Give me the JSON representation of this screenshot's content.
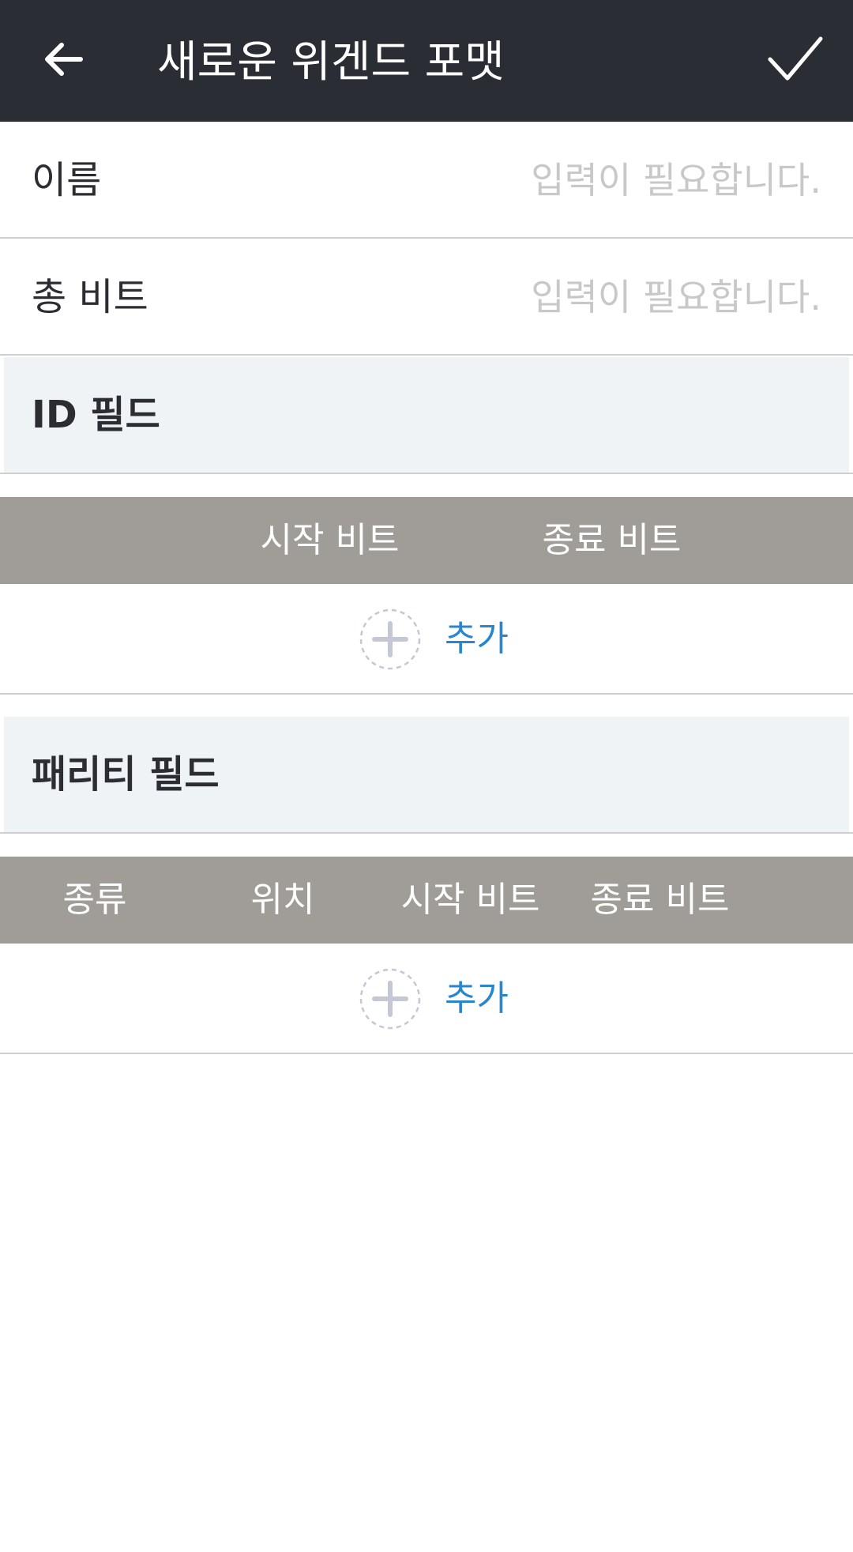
{
  "header": {
    "title": "새로운 위겐드 포맷",
    "back_icon": "arrow-left-icon",
    "confirm_icon": "check-icon"
  },
  "fields": {
    "name": {
      "label": "이름",
      "placeholder": "입력이 필요합니다.",
      "value": ""
    },
    "total_bits": {
      "label": "총 비트",
      "placeholder": "입력이 필요합니다.",
      "value": ""
    }
  },
  "id_section": {
    "title": "ID 필드",
    "columns": [
      "시작 비트",
      "종료 비트"
    ],
    "add_label": "추가"
  },
  "parity_section": {
    "title": "패리티 필드",
    "columns": [
      "종류",
      "위치",
      "시작 비트",
      "종료 비트"
    ],
    "add_label": "추가"
  },
  "colors": {
    "appbar_bg": "#2a2d34",
    "section_header_bg": "#eff3f6",
    "table_header_bg": "#a09d98",
    "accent_blue": "#2a86cc",
    "placeholder": "#c8c8c8"
  }
}
